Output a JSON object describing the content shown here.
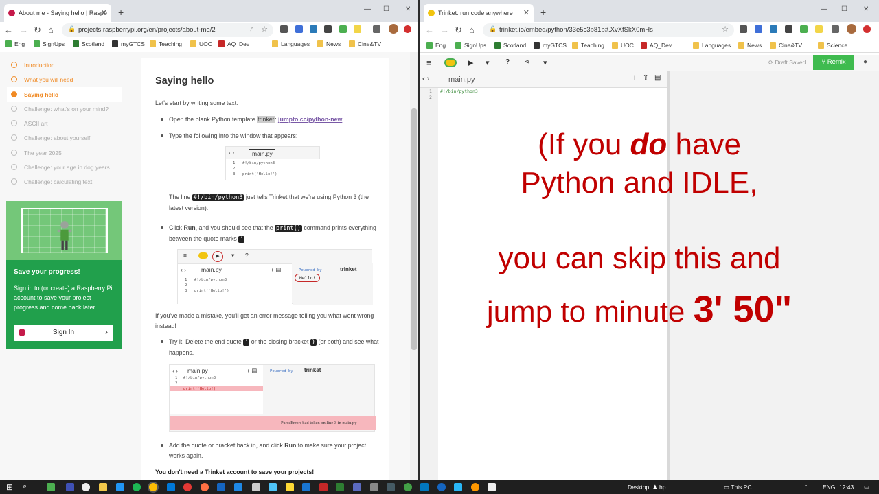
{
  "left_browser": {
    "tab_title": "About me - Saying hello | Raspb",
    "url": "projects.raspberrypi.org/en/projects/about-me/2",
    "bookmarks": [
      "Eng",
      "SignUps",
      "Scotland",
      "myGTCS",
      "Teaching",
      "UOC",
      "AQ_Dev",
      "Languages",
      "News",
      "Cine&TV"
    ],
    "steps": [
      {
        "label": "Introduction",
        "state": "done"
      },
      {
        "label": "What you will need",
        "state": "done"
      },
      {
        "label": "Saying hello",
        "state": "current"
      },
      {
        "label": "Challenge: what's on your mind?",
        "state": "todo"
      },
      {
        "label": "ASCII art",
        "state": "todo"
      },
      {
        "label": "Challenge: about yourself",
        "state": "todo"
      },
      {
        "label": "The year 2025",
        "state": "todo"
      },
      {
        "label": "Challenge: your age in dog years",
        "state": "todo"
      },
      {
        "label": "Challenge: calculating text",
        "state": "todo"
      }
    ],
    "promo": {
      "title": "Save your progress!",
      "text": "Sign in to (or create) a Raspberry Pi account to save your project progress and come back later.",
      "button": "Sign In"
    },
    "article": {
      "heading": "Saying hello",
      "intro": "Let's start by writing some text.",
      "b1_a": "Open the blank Python template ",
      "b1_hl": "trinket",
      "b1_b": ": ",
      "b1_link": "jumpto.cc/python-new",
      "b1_c": ".",
      "b2": "Type the following into the window that appears:",
      "shot_file": "main.py",
      "shot_code": [
        "#!/bin/python3",
        "",
        "print('Hello!')"
      ],
      "p_line_a": "The line ",
      "p_line_code": "#!/bin/python3",
      "p_line_b": " just tells Trinket that we're using Python 3 (the latest version).",
      "b3_a": "Click ",
      "b3_bold": "Run",
      "b3_b": ", and you should see that the ",
      "b3_code": "print()",
      "b3_c": " command prints everything between the quote marks ",
      "b3_code2": "'",
      "powered": "Powered by",
      "trinket": "trinket",
      "hello_out": "Hello!",
      "p_mistake": "If you've made a mistake, you'll get an error message telling you what went wrong instead!",
      "b4_a": "Try it! Delete the end quote ",
      "b4_code1": "'",
      "b4_b": " or the closing bracket ",
      "b4_code2": ")",
      "b4_c": " (or both) and see what happens.",
      "err_code": [
        "#!/bin/python3",
        "",
        "print('Hello!|"
      ],
      "error_msg": "ParseError: bad token on line 3 in main.py",
      "b5_a": "Add the quote or bracket back in, and click ",
      "b5_bold": "Run",
      "b5_b": " to make sure your project works again.",
      "p_bold": "You don't need a Trinket account to save your projects!"
    }
  },
  "right_browser": {
    "tab_title": "Trinket: run code anywhere",
    "url": "trinket.io/embed/python/33e5c3b81b#.XvXfSkX0mHs",
    "bookmarks": [
      "Eng",
      "SignUps",
      "Scotland",
      "myGTCS",
      "Teaching",
      "UOC",
      "AQ_Dev",
      "Languages",
      "News",
      "Cine&TV",
      "Science"
    ],
    "draft": "Draft Saved",
    "remix": "Remix",
    "file": "main.py",
    "gutter": [
      "1",
      "2"
    ],
    "code_line1": "#!/bin/python3",
    "overlay": {
      "l1_a": "(If you ",
      "l1_em": "do",
      "l1_b": " have",
      "l2": "Python and IDLE,",
      "l3": "you can skip this and",
      "l4_a": "jump to minute ",
      "l4_big": "3' 50\""
    }
  },
  "taskbar": {
    "desktop": "Desktop",
    "user": "hp",
    "thispc": "This PC",
    "lang": "ENG",
    "time": "12:43"
  }
}
